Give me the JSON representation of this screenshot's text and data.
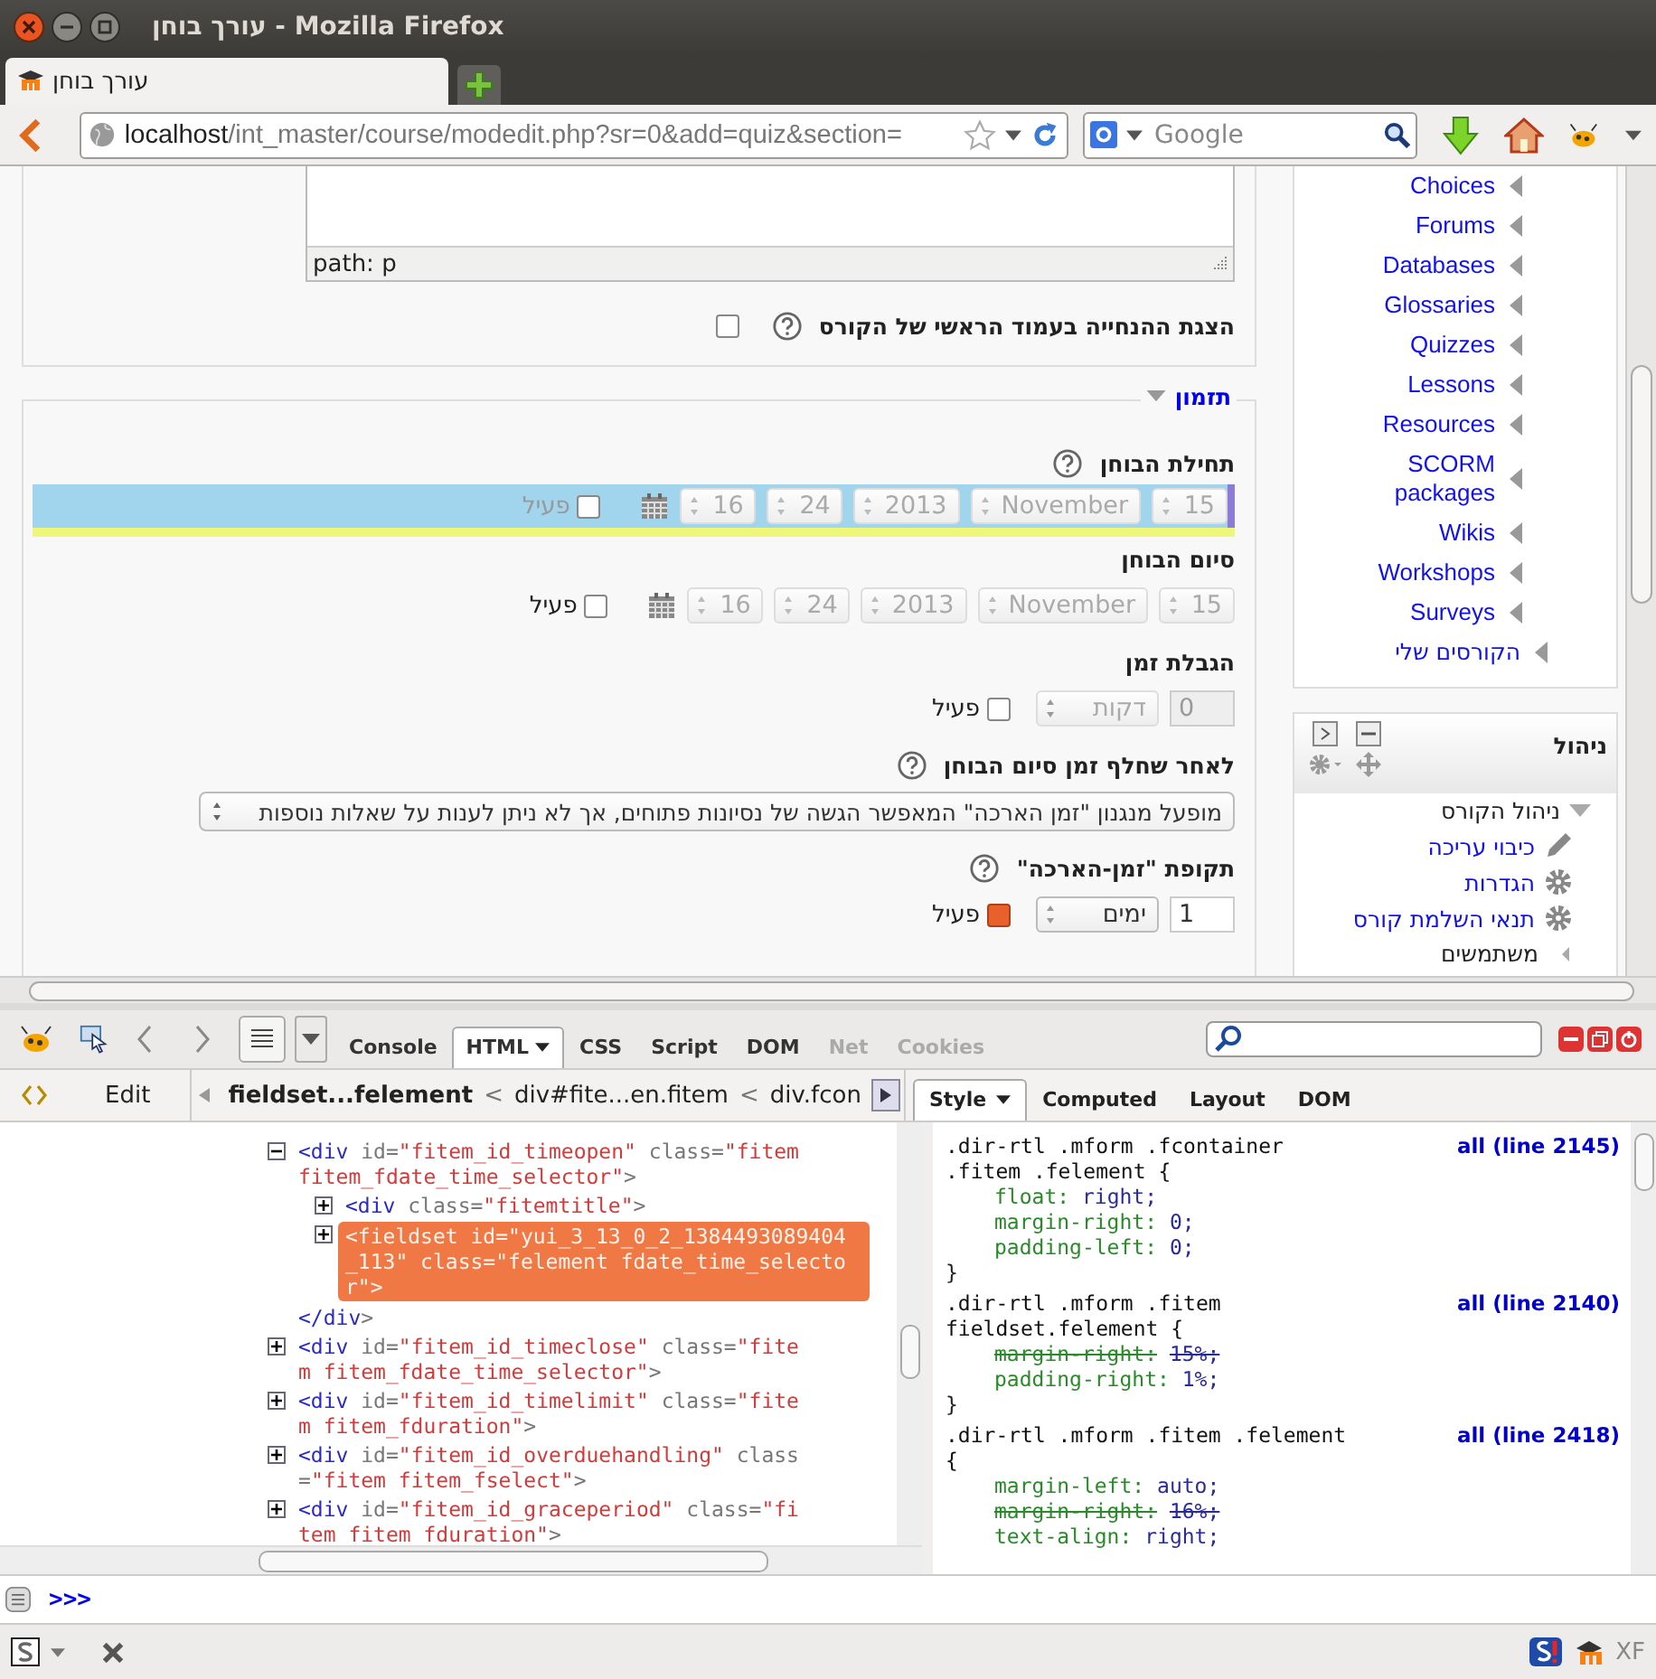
{
  "window": {
    "title": "עורך בוחן - Mozilla Firefox"
  },
  "tabs": [
    {
      "label": "עורך בוחן",
      "selected": true
    }
  ],
  "nav": {
    "url_host": "localhost",
    "url_path": "/int_master/course/modedit.php?sr=0&add=quiz&section=",
    "search_placeholder": "Google"
  },
  "editor": {
    "path": "path: p"
  },
  "show_description": {
    "label": "הצגת ההנחייה בעמוד הראשי של הקורס",
    "checked": false
  },
  "section": {
    "title": "תזמון",
    "expanded": true
  },
  "fields": [
    {
      "kind": "date",
      "label": "תחילת הבוחן",
      "help": true,
      "highlighted": true,
      "selects": [
        "16",
        "24",
        "2013",
        "November",
        "15"
      ],
      "enable_label": "פעיל",
      "enabled": false
    },
    {
      "kind": "date",
      "label": "סיום הבוחן",
      "help": false,
      "highlighted": false,
      "selects": [
        "16",
        "24",
        "2013",
        "November",
        "15"
      ],
      "enable_label": "פעיל",
      "enabled": false
    },
    {
      "kind": "duration",
      "label": "הגבלת זמן",
      "help": false,
      "value": "0",
      "unit": "דקות",
      "enable_label": "פעיל",
      "enabled": false
    },
    {
      "kind": "select",
      "label": "לאחר שחלף זמן סיום הבוחן",
      "help": true,
      "value": "מופעל מנגנון \"זמן הארכה\" המאפשר הגשה של נסיונות פתוחים, אך לא ניתן לענות על שאלות נוספות"
    },
    {
      "kind": "duration",
      "label": "תקופת \"זמן-הארכה\"",
      "help": true,
      "value": "1",
      "unit": "ימים",
      "enable_label": "פעיל",
      "enabled": true
    }
  ],
  "sidebar": {
    "nav_items": [
      "Choices",
      "Forums",
      "Databases",
      "Glossaries",
      "Quizzes",
      "Lessons",
      "Resources",
      "SCORM packages",
      "Wikis",
      "Workshops",
      "Surveys"
    ],
    "my_courses": "הקורסים שלי",
    "admin": {
      "title": "ניהול",
      "items": [
        {
          "label": "ניהול הקורס",
          "kind": "branch",
          "expanded": true,
          "children": [
            {
              "label": "כיבוי עריכה",
              "kind": "edit"
            },
            {
              "label": "הגדרות",
              "kind": "setting"
            },
            {
              "label": "תנאי השלמת קורס",
              "kind": "setting"
            },
            {
              "label": "משתמשים",
              "kind": "branch",
              "expanded": false
            }
          ]
        }
      ]
    }
  },
  "devtools": {
    "tabs": [
      {
        "label": "Console",
        "selected": false,
        "disabled": false,
        "dropdown": false
      },
      {
        "label": "HTML",
        "selected": true,
        "disabled": false,
        "dropdown": true
      },
      {
        "label": "CSS",
        "selected": false,
        "disabled": false,
        "dropdown": false
      },
      {
        "label": "Script",
        "selected": false,
        "disabled": false,
        "dropdown": false
      },
      {
        "label": "DOM",
        "selected": false,
        "disabled": false,
        "dropdown": false
      },
      {
        "label": "Net",
        "selected": false,
        "disabled": true,
        "dropdown": false
      },
      {
        "label": "Cookies",
        "selected": false,
        "disabled": true,
        "dropdown": false
      }
    ],
    "edit_button": "Edit",
    "breadcrumbs": {
      "separator": "<",
      "items": [
        {
          "label": "fieldset...felement",
          "selected": true
        },
        {
          "label": "div#fite...en.fitem",
          "selected": false
        },
        {
          "label": "div.fcon",
          "selected": false
        }
      ]
    },
    "side_tabs": [
      {
        "label": "Style",
        "selected": true,
        "dropdown": true
      },
      {
        "label": "Computed",
        "selected": false,
        "dropdown": false
      },
      {
        "label": "Layout",
        "selected": false,
        "dropdown": false
      },
      {
        "label": "DOM",
        "selected": false,
        "dropdown": false
      }
    ],
    "html_tree": [
      {
        "open": "<div id=\"fitem_id_timeopen\" class=\"fitem fitem_fdate_time_selector\">",
        "expanded": true,
        "selected": false,
        "close": "</div>",
        "children": [
          {
            "open": "<div class=\"fitemtitle\">",
            "expanded": false,
            "selected": false
          },
          {
            "open": "<fieldset id=\"yui_3_13_0_2_1384493089404_113\" class=\"felement fdate_time_selector\">",
            "expanded": false,
            "selected": true
          }
        ]
      },
      {
        "open": "<div id=\"fitem_id_timeclose\" class=\"fitem fitem_fdate_time_selector\">",
        "expanded": false,
        "selected": false
      },
      {
        "open": "<div id=\"fitem_id_timelimit\" class=\"fitem fitem_fduration\">",
        "expanded": false,
        "selected": false
      },
      {
        "open": "<div id=\"fitem_id_overduehandling\" class=\"fitem fitem_fselect\">",
        "expanded": false,
        "selected": false
      },
      {
        "open": "<div id=\"fitem_id_graceperiod\" class=\"fitem fitem_fduration\">",
        "expanded": false,
        "selected": false
      }
    ],
    "css_rules": [
      {
        "selector_lines": [
          ".dir-rtl .mform .fcontainer",
          ".fitem .felement {"
        ],
        "source": "all (line 2145)",
        "props": [
          {
            "name": "float:",
            "value": "right;",
            "overridden": false
          },
          {
            "name": "margin-right:",
            "value": "0;",
            "overridden": false
          },
          {
            "name": "padding-left:",
            "value": "0;",
            "overridden": false
          }
        ],
        "close": "}"
      },
      {
        "selector_lines": [
          ".dir-rtl .mform .fitem",
          "fieldset.felement {"
        ],
        "source": "all (line 2140)",
        "props": [
          {
            "name": "margin-right:",
            "value": "15%;",
            "overridden": true
          },
          {
            "name": "padding-right:",
            "value": "1%;",
            "overridden": false
          }
        ],
        "close": "}"
      },
      {
        "selector_lines": [
          ".dir-rtl .mform .fitem .felement",
          "{"
        ],
        "source": "all (line 2418)",
        "props": [
          {
            "name": "margin-left:",
            "value": "auto;",
            "overridden": false
          },
          {
            "name": "margin-right:",
            "value": "16%;",
            "overridden": true
          },
          {
            "name": "text-align:",
            "value": "right;",
            "overridden": false
          }
        ]
      }
    ],
    "command_prompt": ">>>",
    "status_text": "XF"
  }
}
